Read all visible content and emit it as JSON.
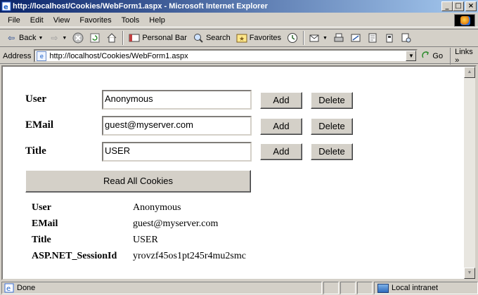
{
  "window": {
    "title": "http://localhost/Cookies/WebForm1.aspx - Microsoft Internet Explorer",
    "controls": [
      "_",
      "□",
      "×"
    ]
  },
  "menu": [
    "File",
    "Edit",
    "View",
    "Favorites",
    "Tools",
    "Help"
  ],
  "toolbar": {
    "back": "Back",
    "personal_bar": "Personal Bar",
    "search": "Search",
    "favorites": "Favorites"
  },
  "address": {
    "label": "Address",
    "url": "http://localhost/Cookies/WebForm1.aspx",
    "go": "Go",
    "links": "Links »"
  },
  "form": {
    "rows": [
      {
        "label": "User",
        "value": "Anonymous",
        "add": "Add",
        "delete": "Delete"
      },
      {
        "label": "EMail",
        "value": "guest@myserver.com",
        "add": "Add",
        "delete": "Delete"
      },
      {
        "label": "Title",
        "value": "USER",
        "add": "Add",
        "delete": "Delete"
      }
    ],
    "read_all": "Read All Cookies"
  },
  "cookies": [
    {
      "key": "User",
      "value": "Anonymous"
    },
    {
      "key": "EMail",
      "value": "guest@myserver.com"
    },
    {
      "key": "Title",
      "value": "USER"
    },
    {
      "key": "ASP.NET_SessionId",
      "value": "yrovzf45os1pt245r4mu2smc"
    }
  ],
  "status": {
    "text": "Done",
    "zone": "Local intranet"
  }
}
